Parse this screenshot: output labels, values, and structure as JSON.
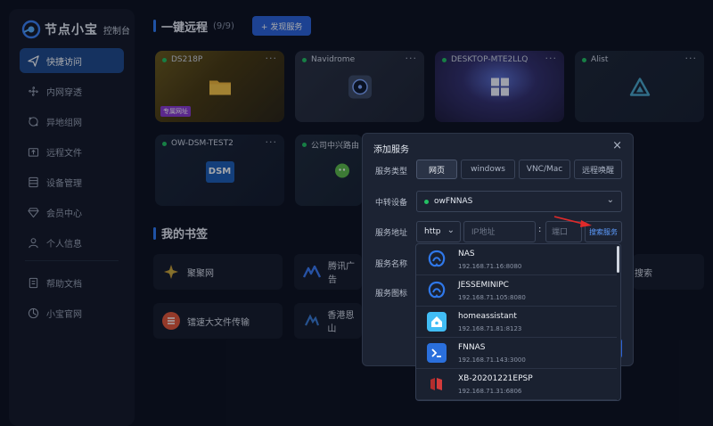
{
  "app": {
    "title": "节点小宝",
    "subtitle": "控制台"
  },
  "sidebar": {
    "items": [
      {
        "label": "快捷访问",
        "icon": "paper-plane-icon",
        "active": true
      },
      {
        "label": "内网穿透",
        "icon": "fan-icon"
      },
      {
        "label": "异地组网",
        "icon": "network-icon"
      },
      {
        "label": "远程文件",
        "icon": "folder-icon"
      },
      {
        "label": "设备管理",
        "icon": "device-icon"
      },
      {
        "label": "会员中心",
        "icon": "diamond-icon"
      },
      {
        "label": "个人信息",
        "icon": "user-icon"
      },
      {
        "label": "帮助文档",
        "icon": "book-icon"
      },
      {
        "label": "小宝官网",
        "icon": "globe-icon"
      }
    ]
  },
  "remote": {
    "title": "一键远程",
    "count": "(9/9)",
    "discover_label": "+ 发现服务",
    "cards": [
      {
        "name": "DS218P",
        "tag": "专属网址",
        "icon": "folder-icon"
      },
      {
        "name": "Navidrome",
        "icon": "disc-icon"
      },
      {
        "name": "DESKTOP-MTE2LLQ",
        "icon": "windows-icon"
      },
      {
        "name": "Alist",
        "icon": "alist-icon"
      },
      {
        "name": "OW-DSM-TEST2",
        "icon": "dsm-icon",
        "icon_text": "DSM"
      },
      {
        "name": "公司中兴路由",
        "icon": "wechat-icon"
      }
    ]
  },
  "bookmarks": {
    "title": "我的书签",
    "items": [
      {
        "label": "聚聚网"
      },
      {
        "label": "腾讯广告"
      },
      {
        "label": "搜索"
      },
      {
        "label": "镭速大文件传输"
      },
      {
        "label": "香港恩山"
      }
    ]
  },
  "modal": {
    "title": "添加服务",
    "close": "×",
    "service_type_label": "服务类型",
    "service_types": [
      "网页",
      "windows",
      "VNC/Mac",
      "远程唤醒"
    ],
    "relay_label": "中转设备",
    "relay_value": "owFNNAS",
    "address_label": "服务地址",
    "protocol": "http",
    "ip_placeholder": "IP地址",
    "port_placeholder": "端口",
    "colon": ":",
    "search_label": "搜索服务",
    "name_label": "服务名称",
    "icon_label": "服务图标"
  },
  "dropdown": {
    "items": [
      {
        "name": "NAS",
        "addr": "192.168.71.16:8080",
        "icon": "fnnas-icon",
        "color": "#1f6fe0"
      },
      {
        "name": "JESSEMINIPC",
        "addr": "192.168.71.105:8080",
        "icon": "fnnas-icon",
        "color": "#1f6fe0"
      },
      {
        "name": "homeassistant",
        "addr": "192.168.71.81:8123",
        "icon": "home-assistant-icon",
        "color": "#41bdf5"
      },
      {
        "name": "FNNAS",
        "addr": "192.168.71.143:3000",
        "icon": "terminal-icon",
        "color": "#2a6fdc"
      },
      {
        "name": "XB-20201221EPSP",
        "addr": "192.168.71.31:6806",
        "icon": "bookmark-icon",
        "color": "#d23b3b"
      }
    ]
  }
}
